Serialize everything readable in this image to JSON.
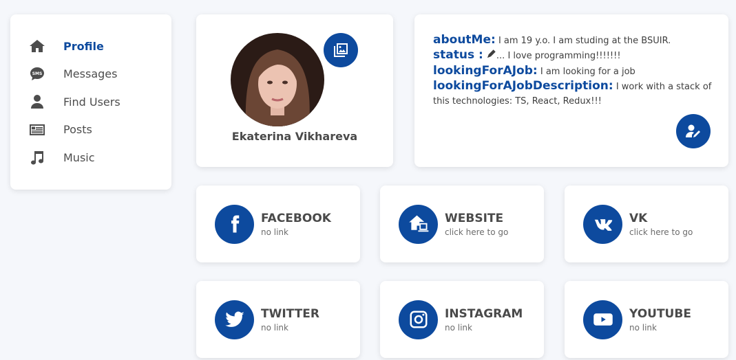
{
  "colors": {
    "accent": "#0d4a9e",
    "background": "#f5f7fb",
    "card": "#ffffff"
  },
  "sidebar": {
    "items": [
      {
        "label": "Profile",
        "icon": "home-icon",
        "active": true
      },
      {
        "label": "Messages",
        "icon": "sms-icon",
        "active": false
      },
      {
        "label": "Find Users",
        "icon": "user-icon",
        "active": false
      },
      {
        "label": "Posts",
        "icon": "newspaper-icon",
        "active": false
      },
      {
        "label": "Music",
        "icon": "music-note-icon",
        "active": false
      }
    ]
  },
  "profile": {
    "name": "Ekaterina Vikhareva",
    "photo_button_icon": "images-icon"
  },
  "about": {
    "about_key": "aboutMe:",
    "about_value": "I am 19 y.o. I am studing at the BSUIR.",
    "status_key": "status :",
    "status_value": "... I love programming!!!!!!!",
    "looking_key": "lookingForAJob:",
    "looking_value": "I am looking for a job",
    "desc_key": "lookingForAJobDescription:",
    "desc_value": "I work with a stack of this technologies: TS, React, Redux!!!",
    "edit_icon": "user-edit-icon"
  },
  "socials": [
    {
      "name": "FACEBOOK",
      "link": "no link",
      "icon": "facebook-icon"
    },
    {
      "name": "WEBSITE",
      "link": "click here to go",
      "icon": "home-laptop-icon"
    },
    {
      "name": "VK",
      "link": "click here to go",
      "icon": "vk-icon"
    },
    {
      "name": "TWITTER",
      "link": "no link",
      "icon": "twitter-icon"
    },
    {
      "name": "INSTAGRAM",
      "link": "no link",
      "icon": "instagram-icon"
    },
    {
      "name": "YOUTUBE",
      "link": "no link",
      "icon": "youtube-icon"
    }
  ]
}
